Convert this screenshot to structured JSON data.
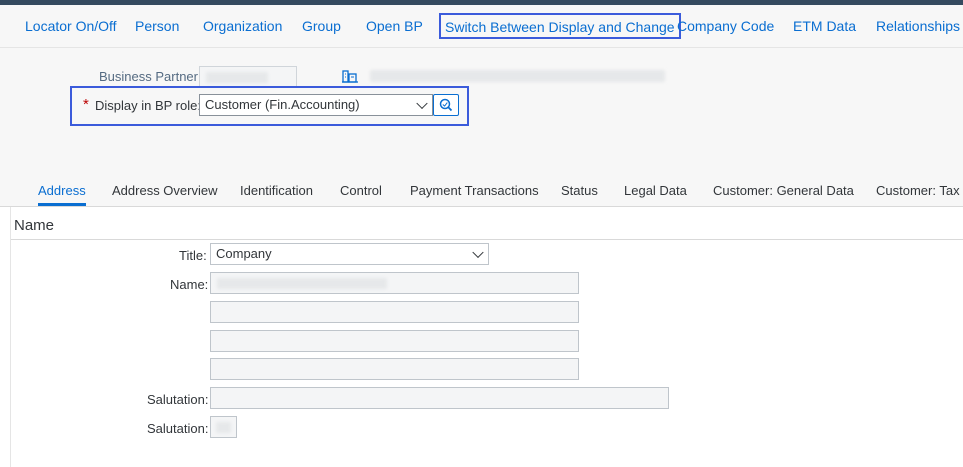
{
  "toolbar": {
    "items": [
      {
        "label": "Locator On/Off"
      },
      {
        "label": "Person"
      },
      {
        "label": "Organization"
      },
      {
        "label": "Group"
      },
      {
        "label": "Open BP"
      },
      {
        "label": "Switch Between Display and Change"
      },
      {
        "label": "Company Code"
      },
      {
        "label": "ETM Data"
      },
      {
        "label": "Relationships"
      }
    ]
  },
  "header": {
    "business_partner_label": "Business Partner:",
    "required_marker": "*",
    "role_label": "Display in BP role:",
    "role_value": "Customer (Fin.Accounting)"
  },
  "tabs": [
    {
      "label": "Address"
    },
    {
      "label": "Address Overview"
    },
    {
      "label": "Identification"
    },
    {
      "label": "Control"
    },
    {
      "label": "Payment Transactions"
    },
    {
      "label": "Status"
    },
    {
      "label": "Legal Data"
    },
    {
      "label": "Customer: General Data"
    },
    {
      "label": "Customer: Tax Data"
    }
  ],
  "section": {
    "title": "Name",
    "title_label": "Title:",
    "title_value": "Company",
    "name_label": "Name:",
    "salutation_label": "Salutation:",
    "salutation2_label": "Salutation:"
  },
  "colors": {
    "accent": "#0a6ed1",
    "highlight_border": "#3b5bdb",
    "shell_bar": "#354a5f"
  }
}
